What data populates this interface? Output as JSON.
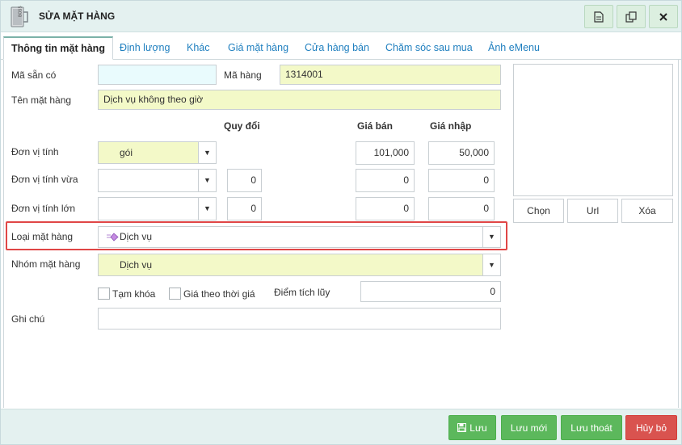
{
  "window": {
    "title": "SỬA MẶT HÀNG"
  },
  "tabs": [
    {
      "label": "Thông tin mặt hàng",
      "active": true
    },
    {
      "label": "Định lượng"
    },
    {
      "label": "Khác"
    },
    {
      "label": "Giá mặt hàng"
    },
    {
      "label": "Cửa hàng bán"
    },
    {
      "label": "Chăm sóc sau mua"
    },
    {
      "label": "Ảnh eMenu"
    }
  ],
  "form": {
    "ma_san_co": {
      "label": "Mã sẵn có",
      "value": ""
    },
    "ma_hang": {
      "label": "Mã hàng",
      "value": "1314001"
    },
    "ten_mat_hang": {
      "label": "Tên mặt hàng",
      "value": "Dịch vụ không theo giờ"
    },
    "headers": {
      "quy_doi": "Quy đổi",
      "gia_ban": "Giá bán",
      "gia_nhap": "Giá nhập"
    },
    "don_vi_tinh": {
      "label": "Đơn vị tính",
      "value": "gói",
      "gia_ban": "101,000",
      "gia_nhap": "50,000"
    },
    "don_vi_tinh_vua": {
      "label": "Đơn vị tính vừa",
      "value": "",
      "quy_doi": "0",
      "gia_ban": "0",
      "gia_nhap": "0"
    },
    "don_vi_tinh_lon": {
      "label": "Đơn vị tính lớn",
      "value": "",
      "quy_doi": "0",
      "gia_ban": "0",
      "gia_nhap": "0"
    },
    "loai_mat_hang": {
      "label": "Loại mặt hàng",
      "value": "Dịch vụ"
    },
    "nhom_mat_hang": {
      "label": "Nhóm mặt hàng",
      "value": "Dịch vụ"
    },
    "tam_khoa": {
      "label": "Tạm khóa",
      "checked": false
    },
    "gia_theo_thoi_gia": {
      "label": "Giá theo thời giá",
      "checked": false
    },
    "diem_tich_luy": {
      "label": "Điểm tích lũy",
      "value": "0"
    },
    "ghi_chu": {
      "label": "Ghi chú",
      "value": ""
    }
  },
  "image_buttons": {
    "chon": "Chọn",
    "url": "Url",
    "xoa": "Xóa"
  },
  "footer": {
    "luu": "Lưu",
    "luu_moi": "Lưu mới",
    "luu_thoat": "Lưu thoát",
    "huy_bo": "Hủy bỏ"
  },
  "colors": {
    "accent_green": "#5cb85c",
    "danger_red": "#d9534f",
    "highlight_border": "#e04646",
    "required_field": "#f3f9c8"
  }
}
